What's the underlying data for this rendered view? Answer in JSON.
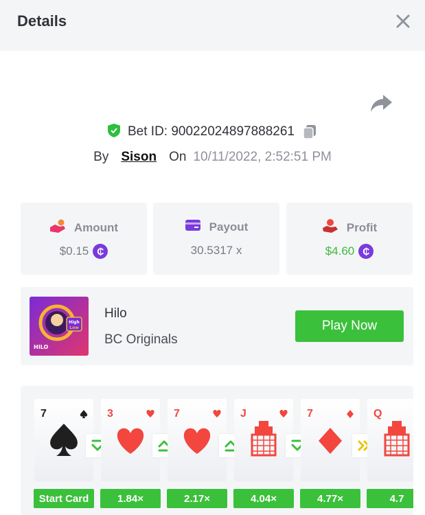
{
  "header": {
    "title": "Details"
  },
  "bet": {
    "id_text": "Bet ID: 90022024897888261",
    "by_label": "By",
    "username": "Sison",
    "on_label": "On",
    "datetime": "10/11/2022, 2:52:51 PM"
  },
  "stats": {
    "amount": {
      "label": "Amount",
      "value": "$0.15",
      "icon": "money-hand-icon"
    },
    "payout": {
      "label": "Payout",
      "value": "30.5317 x",
      "icon": "card-icon"
    },
    "profit": {
      "label": "Profit",
      "value": "$4.60",
      "icon": "profit-hand-icon"
    }
  },
  "coin_symbol": "₵",
  "game": {
    "name": "Hilo",
    "provider": "BC Originals",
    "play_label": "Play Now",
    "thumb_text": "HILO",
    "thumb_badge_top": "High",
    "thumb_badge_bottom": "Low"
  },
  "colors": {
    "green": "#3bc03b",
    "red": "#f2463f",
    "coin": "#7a3bdb",
    "shield": "#2dbf3e"
  },
  "cards": [
    {
      "rank": "7",
      "suit": "spade",
      "color": "#1f1f1f",
      "multiplier": "Start Card",
      "arrow": "down",
      "arrow_color": "#3bc03b"
    },
    {
      "rank": "3",
      "suit": "heart",
      "color": "#f2463f",
      "multiplier": "1.84×",
      "arrow": "up",
      "arrow_color": "#3bc03b"
    },
    {
      "rank": "7",
      "suit": "heart",
      "color": "#f2463f",
      "multiplier": "2.17×",
      "arrow": "up",
      "arrow_color": "#3bc03b"
    },
    {
      "rank": "J",
      "suit": "heart",
      "color": "#f2463f",
      "multiplier": "4.04×",
      "arrow": "down",
      "arrow_color": "#3bc03b"
    },
    {
      "rank": "7",
      "suit": "diamond",
      "color": "#f2463f",
      "multiplier": "4.77×",
      "arrow": "skip",
      "arrow_color": "#e8c30c"
    },
    {
      "rank": "Q",
      "suit": "diamond",
      "color": "#f2463f",
      "multiplier": "4.7",
      "arrow": null,
      "arrow_color": ""
    }
  ]
}
